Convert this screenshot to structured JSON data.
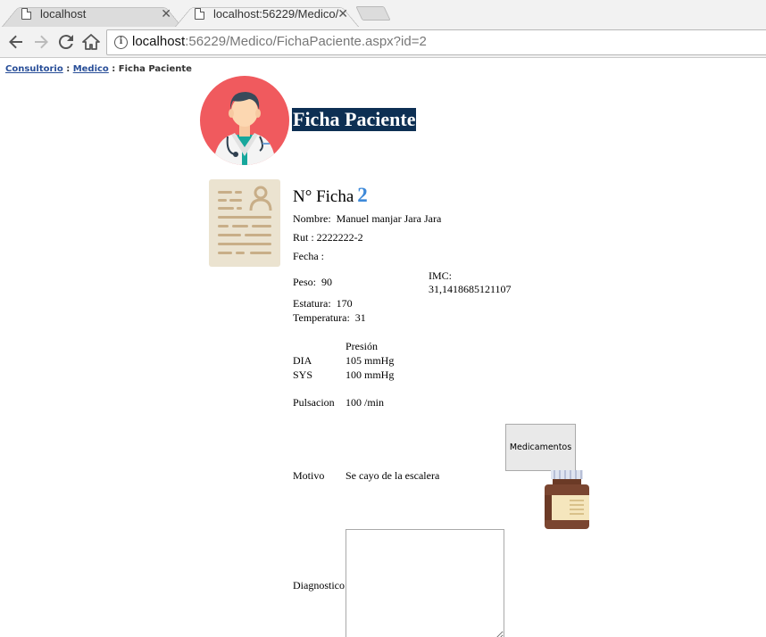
{
  "browser": {
    "tabs": [
      {
        "label": "localhost",
        "close": "✕"
      },
      {
        "label": "localhost:56229/Medico/",
        "close": "✕"
      }
    ],
    "url_host": "localhost",
    "url_rest": ":56229/Medico/FichaPaciente.aspx?id=2"
  },
  "breadcrumb": {
    "root": "Consultorio",
    "sep1": ":",
    "mid": "Medico",
    "sep2": ":",
    "current": "Ficha Paciente"
  },
  "page": {
    "title": "Ficha Paciente",
    "ficha_label": "N° Ficha",
    "ficha_number": "2"
  },
  "patient": {
    "nombre_label": "Nombre:",
    "nombre_value": "Manuel manjar Jara Jara",
    "rut_label": "Rut :",
    "rut_value": "2222222-2",
    "fecha_label": "Fecha :",
    "fecha_value": "",
    "peso_label": "Peso:",
    "peso_value": "90",
    "imc_label": "IMC:",
    "imc_value": "31,1418685121107",
    "estatura_label": "Estatura:",
    "estatura_value": "170",
    "temperatura_label": "Temperatura:",
    "temperatura_value": "31"
  },
  "presion": {
    "header": "Presión",
    "dia_label": "DIA",
    "dia_value": "105 mmHg",
    "sys_label": "SYS",
    "sys_value": "100 mmHg"
  },
  "pulsacion": {
    "label": "Pulsacion",
    "value": "100 /min"
  },
  "motivo": {
    "label": "Motivo",
    "value": "Se cayo de la escalera"
  },
  "diagnostico": {
    "label": "Diagnostico",
    "value": ""
  },
  "actions": {
    "medicamentos_label": "Medicamentos"
  },
  "colors": {
    "title_bg": "#0d2f53",
    "ficha_number": "#3d89d9",
    "link": "#284e98",
    "avatar_bg": "#f05a5e"
  },
  "icons": [
    "page-icon",
    "close-icon",
    "back-icon",
    "forward-icon",
    "reload-icon",
    "home-icon",
    "info-icon",
    "doctor-avatar-icon",
    "id-card-icon",
    "medicine-bottle-icon"
  ]
}
